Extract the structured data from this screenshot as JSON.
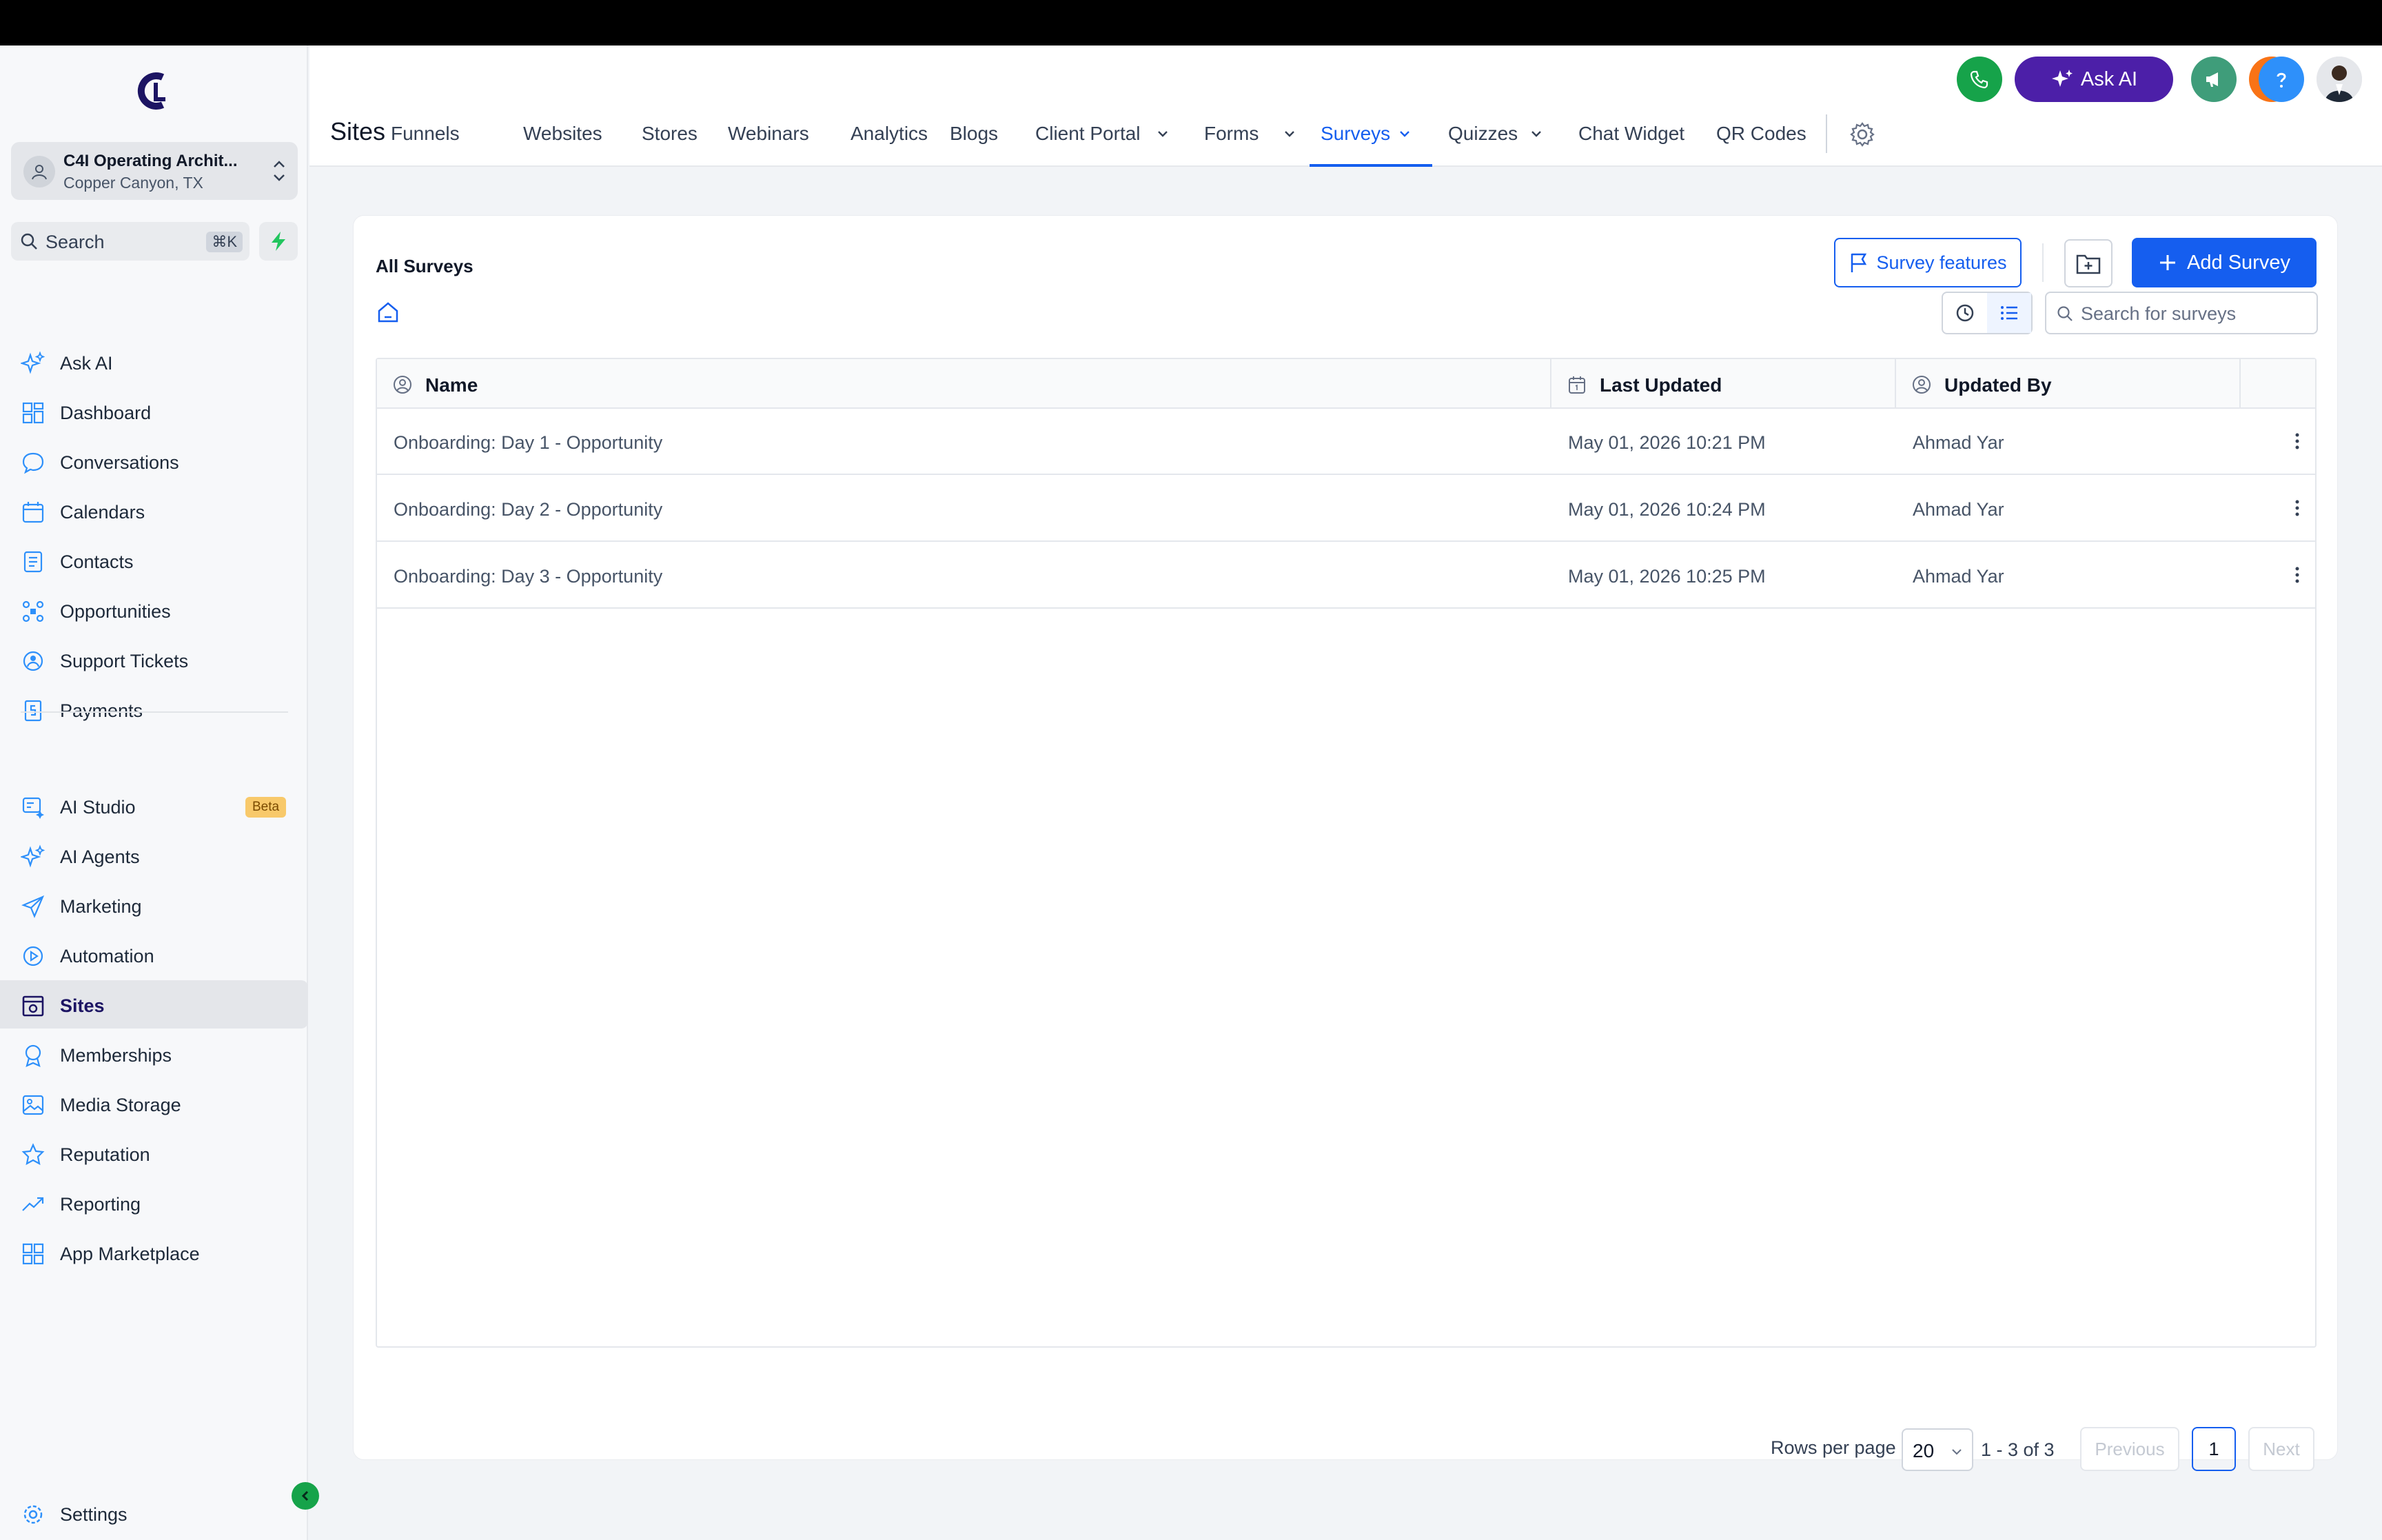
{
  "account": {
    "name": "C4I Operating Archit...",
    "location": "Copper Canyon, TX"
  },
  "search": {
    "label": "Search",
    "shortcut": "⌘K"
  },
  "sidebar": {
    "items": [
      {
        "label": "Ask AI",
        "icon": "sparkle-icon"
      },
      {
        "label": "Dashboard",
        "icon": "dashboard-icon"
      },
      {
        "label": "Conversations",
        "icon": "chat-bubble-icon"
      },
      {
        "label": "Calendars",
        "icon": "calendar-icon"
      },
      {
        "label": "Contacts",
        "icon": "contacts-icon"
      },
      {
        "label": "Opportunities",
        "icon": "opportunities-icon"
      },
      {
        "label": "Support Tickets",
        "icon": "support-icon"
      },
      {
        "label": "Payments",
        "icon": "payments-icon"
      }
    ],
    "items2": [
      {
        "label": "AI Studio",
        "icon": "ai-studio-icon",
        "badge": "Beta"
      },
      {
        "label": "AI Agents",
        "icon": "sparkle-icon"
      },
      {
        "label": "Marketing",
        "icon": "send-icon"
      },
      {
        "label": "Automation",
        "icon": "automation-icon"
      },
      {
        "label": "Sites",
        "icon": "sites-icon",
        "active": true
      },
      {
        "label": "Memberships",
        "icon": "badge-icon"
      },
      {
        "label": "Media Storage",
        "icon": "image-icon"
      },
      {
        "label": "Reputation",
        "icon": "star-icon"
      },
      {
        "label": "Reporting",
        "icon": "trend-icon"
      },
      {
        "label": "App Marketplace",
        "icon": "grid-icon"
      }
    ],
    "settings_label": "Settings"
  },
  "header": {
    "title": "Sites",
    "ask_ai_label": "Ask AI",
    "tabs": [
      {
        "label": "Funnels"
      },
      {
        "label": "Websites"
      },
      {
        "label": "Stores"
      },
      {
        "label": "Webinars"
      },
      {
        "label": "Analytics"
      },
      {
        "label": "Blogs"
      },
      {
        "label": "Client Portal",
        "dropdown": true
      },
      {
        "label": "Forms",
        "dropdown": true
      },
      {
        "label": "Surveys",
        "dropdown": true,
        "active": true
      },
      {
        "label": "Quizzes",
        "dropdown": true
      },
      {
        "label": "Chat Widget"
      },
      {
        "label": "QR Codes"
      }
    ]
  },
  "main": {
    "title": "All Surveys",
    "features_label": "Survey features",
    "add_label": "Add Survey",
    "search_placeholder": "Search for surveys",
    "columns": [
      "Name",
      "Last Updated",
      "Updated By"
    ],
    "rows": [
      {
        "name": "Onboarding: Day 1 - Opportunity",
        "updated": "May 01, 2026 10:21 PM",
        "by": "Ahmad Yar"
      },
      {
        "name": "Onboarding: Day 2 - Opportunity",
        "updated": "May 01, 2026 10:24 PM",
        "by": "Ahmad Yar"
      },
      {
        "name": "Onboarding: Day 3 - Opportunity",
        "updated": "May 01, 2026 10:25 PM",
        "by": "Ahmad Yar"
      }
    ],
    "pagination": {
      "rows_per_page_label": "Rows per page",
      "rows_per_page": "20",
      "range": "1 - 3 of 3",
      "previous": "Previous",
      "page": "1",
      "next": "Next"
    }
  },
  "colors": {
    "accent": "#155eef",
    "ask_ai": "#4c1fa8",
    "call": "#16a34a",
    "notify": "#f97316",
    "help": "#2e90fa",
    "announce": "#3f9d7a"
  }
}
